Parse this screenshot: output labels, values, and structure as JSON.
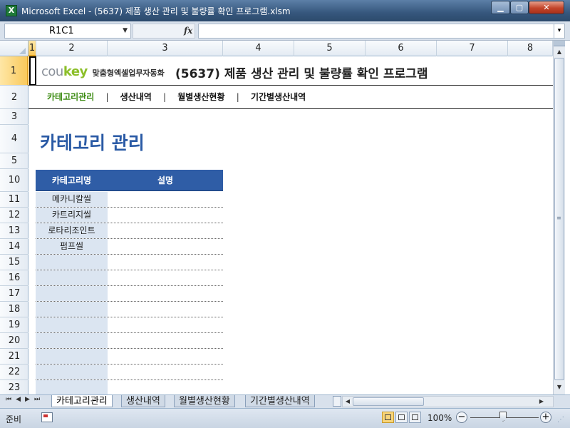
{
  "window": {
    "title": "Microsoft Excel - (5637) 제품 생산 관리 및 불량률 확인 프로그램.xlsm",
    "app_icon": "excel-icon",
    "controls": {
      "minimize": "▁",
      "maximize": "▢",
      "close": "✕"
    }
  },
  "formula_bar": {
    "name_box": "R1C1",
    "fx": "fx",
    "formula": ""
  },
  "columns": [
    "1",
    "2",
    "3",
    "4",
    "5",
    "6",
    "7",
    "8"
  ],
  "rows": [
    "1",
    "2",
    "3",
    "4",
    "5",
    "10",
    "11",
    "12",
    "13",
    "14",
    "15",
    "16",
    "17",
    "18",
    "19",
    "20",
    "21",
    "22",
    "23"
  ],
  "sheet": {
    "logo_en_gray": "cou",
    "logo_en_green": "key",
    "logo_ko": "맞춤형엑셀업무자동화",
    "doc_title": "(5637) 제품 생산 관리 및 불량률 확인 프로그램",
    "nav": [
      "카테고리관리",
      "생산내역",
      "월별생산현황",
      "기간별생산내역"
    ],
    "nav_separator": "|",
    "section_title": "카테고리 관리",
    "table": {
      "headers": [
        "카테고리명",
        "설명"
      ],
      "rows": [
        [
          "메카니칼씰",
          ""
        ],
        [
          "카트리지씰",
          ""
        ],
        [
          "로타리조인트",
          ""
        ],
        [
          "펌프씰",
          ""
        ],
        [
          "",
          ""
        ],
        [
          "",
          ""
        ],
        [
          "",
          ""
        ],
        [
          "",
          ""
        ],
        [
          "",
          ""
        ],
        [
          "",
          ""
        ],
        [
          "",
          ""
        ],
        [
          "",
          ""
        ],
        [
          "",
          ""
        ]
      ]
    }
  },
  "tabs": [
    {
      "label": "카테고리관리",
      "active": true
    },
    {
      "label": "생산내역",
      "active": false
    },
    {
      "label": "월별생산현황",
      "active": false
    },
    {
      "label": "기간별생산내역",
      "active": false
    }
  ],
  "status": {
    "ready": "준비",
    "zoom": "100%"
  },
  "colors": {
    "table_header": "#2f5da6",
    "section_title": "#2a5aa5",
    "category_cell": "#dbe5f1",
    "active_nav": "#3a8a10"
  }
}
